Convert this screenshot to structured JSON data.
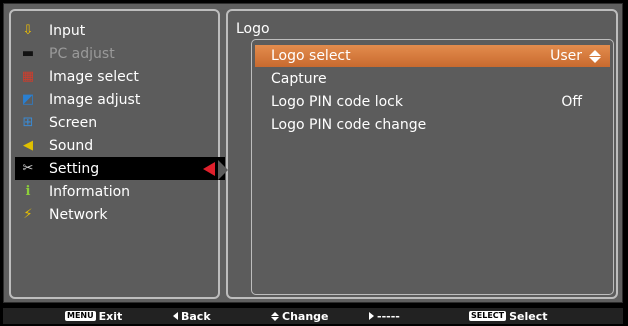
{
  "menu": {
    "items": [
      {
        "label": "Input",
        "icon": "input-icon",
        "glyph": "⇩",
        "color": "#f2c200",
        "disabled": false
      },
      {
        "label": "PC adjust",
        "icon": "pc-adjust-icon",
        "glyph": "▬",
        "color": "#1a1a1a",
        "disabled": true
      },
      {
        "label": "Image select",
        "icon": "image-select-icon",
        "glyph": "▦",
        "color": "#d33c2a",
        "disabled": false
      },
      {
        "label": "Image adjust",
        "icon": "image-adjust-icon",
        "glyph": "◩",
        "color": "#2a7fd0",
        "disabled": false
      },
      {
        "label": "Screen",
        "icon": "screen-icon",
        "glyph": "⊞",
        "color": "#3a8ad4",
        "disabled": false
      },
      {
        "label": "Sound",
        "icon": "sound-icon",
        "glyph": "◀)",
        "color": "#e0c000",
        "disabled": false
      },
      {
        "label": "Setting",
        "icon": "setting-icon",
        "glyph": "✂",
        "color": "#d9d9d9",
        "disabled": false,
        "active": true
      },
      {
        "label": "Information",
        "icon": "information-icon",
        "glyph": "i",
        "color": "#8ccf3a",
        "disabled": false
      },
      {
        "label": "Network",
        "icon": "network-icon",
        "glyph": "⚡",
        "color": "#e8c000",
        "disabled": false
      }
    ]
  },
  "submenu": {
    "title": "Logo",
    "rows": [
      {
        "label": "Logo select",
        "value": "User",
        "selected": true
      },
      {
        "label": "Capture",
        "value": ""
      },
      {
        "label": "Logo PIN code lock",
        "value": "Off"
      },
      {
        "label": "Logo PIN code change",
        "value": ""
      }
    ]
  },
  "statusbar": {
    "exit_key": "MENU",
    "exit_label": "Exit",
    "back_label": "Back",
    "change_label": "Change",
    "next_label": "-----",
    "select_key": "SELECT",
    "select_label": "Select"
  },
  "colors": {
    "highlight": "#d8783a",
    "active_arrow": "#e0202c",
    "panel": "#5c5c5c",
    "border": "#bdbdbd"
  }
}
